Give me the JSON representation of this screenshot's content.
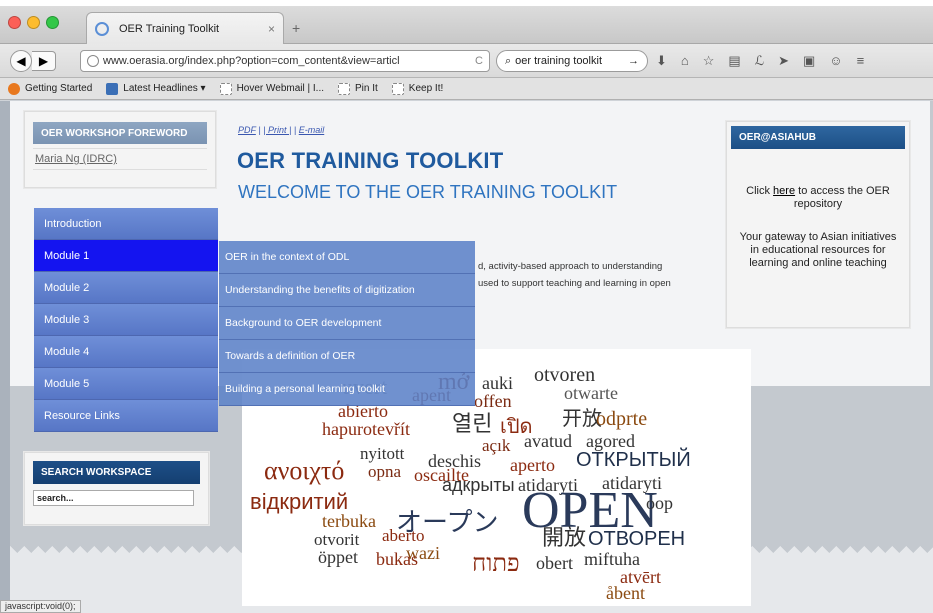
{
  "browser": {
    "tab_title": "OER Training Toolkit",
    "tab_close": "×",
    "new_tab": "+",
    "url": "www.oerasia.org/index.php?option=com_content&view=articl",
    "search_text": "oer training toolkit",
    "search_go": "→",
    "url_reload": "C",
    "tool_icons": [
      "⬇",
      "⌂",
      "☆",
      "▤",
      "ℒ",
      "➤",
      "▣",
      "☺",
      "≡"
    ]
  },
  "bookmarks": [
    {
      "label": "Getting Started",
      "icon": "firefox-icon"
    },
    {
      "label": "Latest Headlines ▾",
      "icon": "rss-icon"
    },
    {
      "label": "Hover Webmail | I...",
      "icon": "page-icon"
    },
    {
      "label": "Pin It",
      "icon": "page-icon"
    },
    {
      "label": "Keep It!",
      "icon": "page-icon"
    }
  ],
  "sidebar": {
    "foreword_title": "OER WORKSHOP FOREWORD",
    "foreword_link": "Maria Ng (IDRC)",
    "menu": [
      {
        "label": "Introduction",
        "active": false
      },
      {
        "label": "Module 1",
        "active": true
      },
      {
        "label": "Module 2",
        "active": false
      },
      {
        "label": "Module 3",
        "active": false
      },
      {
        "label": "Module 4",
        "active": false
      },
      {
        "label": "Module 5",
        "active": false
      },
      {
        "label": "Resource Links",
        "active": false
      }
    ],
    "submenu": [
      "OER in the context of ODL",
      "Understanding the benefits of digitization",
      "Background to OER development",
      "Towards a definition of OER",
      "Building a personal learning toolkit"
    ],
    "search_title": "SEARCH WORKSPACE",
    "search_value": "search..."
  },
  "main": {
    "links": {
      "pdf": "PDF",
      "sep1": " | ",
      "print": "| Print |",
      "sep2": " | ",
      "email": "E-mail"
    },
    "title": "OER TRAINING TOOLKIT",
    "subtitle": "WELCOME TO THE OER TRAINING TOOLKIT",
    "intro_visible": "d, activity-based approach to understanding",
    "intro_visible2": "used to support teaching and learning in open"
  },
  "hub": {
    "title": "OER@ASIAHUB",
    "text_pre": "Click ",
    "link": "here",
    "text_post": " to access the OER repository",
    "text2": "Your gateway to Asian initiatives in educational resources for learning and online teaching"
  },
  "status": "javascript:void(0);",
  "colors": {
    "accent": "#1414f0",
    "title": "#1f5a9e",
    "menu": "#5776c6"
  }
}
